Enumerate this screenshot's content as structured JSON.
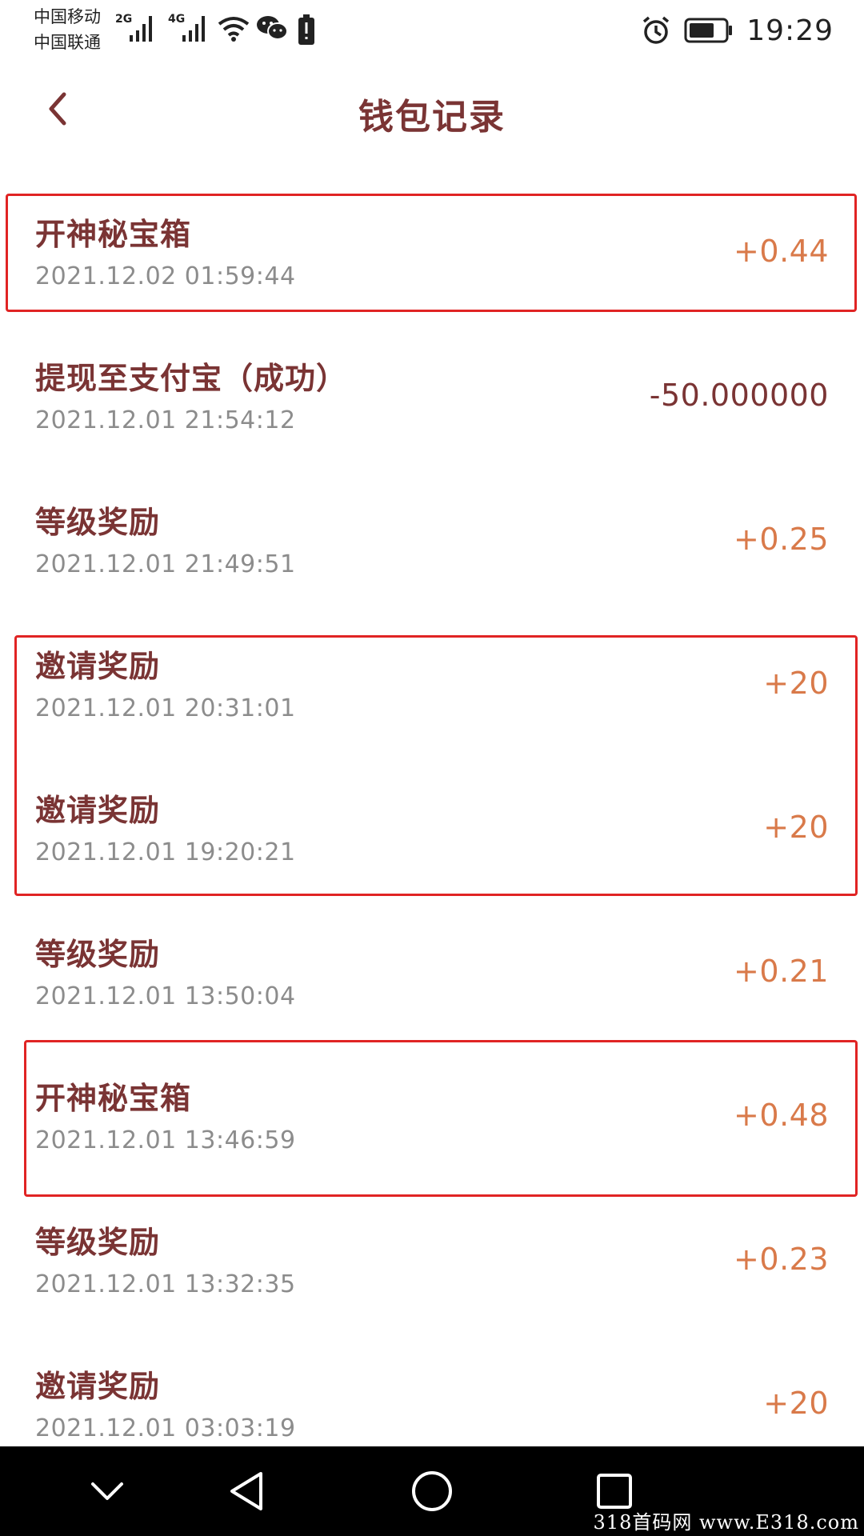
{
  "status_bar": {
    "carrier_1": "中国移动",
    "carrier_2": "中国联通",
    "net_1": "2G",
    "net_2": "4G",
    "time": "19:29",
    "icons": [
      "signal-icon",
      "wifi-icon",
      "wechat-icon",
      "alert-battery-icon",
      "alarm-icon",
      "battery-icon"
    ]
  },
  "header": {
    "title": "钱包记录",
    "back_icon": "chevron-left-icon"
  },
  "records": [
    {
      "title": "开神秘宝箱",
      "time": "2021.12.02 01:59:44",
      "amount": "+0.44"
    },
    {
      "title": "提现至支付宝（成功）",
      "time": "2021.12.01 21:54:12",
      "amount": "-50.000000"
    },
    {
      "title": "等级奖励",
      "time": "2021.12.01 21:49:51",
      "amount": "+0.25"
    },
    {
      "title": "邀请奖励",
      "time": "2021.12.01 20:31:01",
      "amount": "+20"
    },
    {
      "title": "邀请奖励",
      "time": "2021.12.01 19:20:21",
      "amount": "+20"
    },
    {
      "title": "等级奖励",
      "time": "2021.12.01 13:50:04",
      "amount": "+0.21"
    },
    {
      "title": "开神秘宝箱",
      "time": "2021.12.01 13:46:59",
      "amount": "+0.48"
    },
    {
      "title": "等级奖励",
      "time": "2021.12.01 13:32:35",
      "amount": "+0.23"
    },
    {
      "title": "邀请奖励",
      "time": "2021.12.01 03:03:19",
      "amount": "+20"
    }
  ],
  "colors": {
    "title": "#7a3434",
    "amount_positive": "#d97a4a",
    "amount_negative": "#7a3434",
    "highlight": "#e02424",
    "nav_bar": "#000000"
  },
  "nav_bar": {
    "icons": [
      "chevron-down-icon",
      "back-triangle-icon",
      "home-circle-icon",
      "recents-square-icon"
    ]
  },
  "watermark": "318首码网 www.E318.com"
}
